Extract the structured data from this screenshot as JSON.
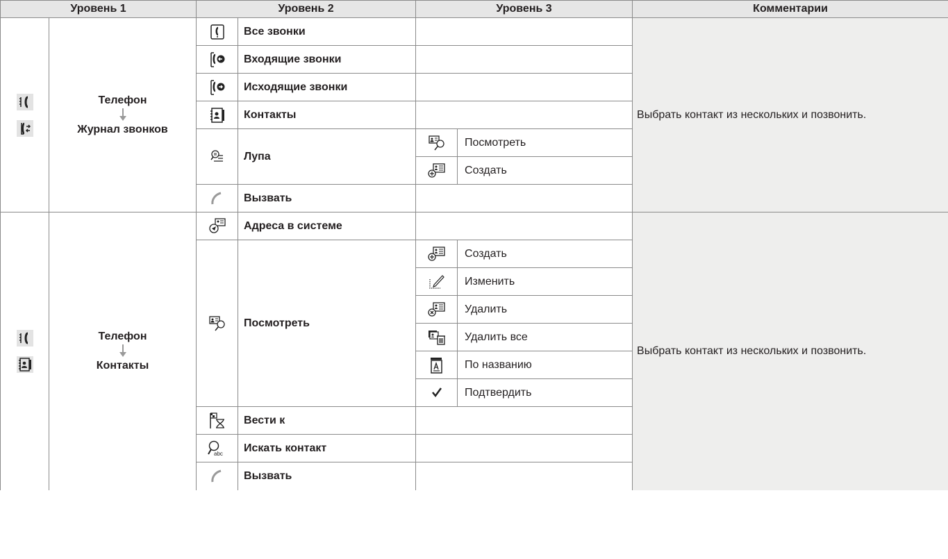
{
  "header": {
    "level1": "Уровень 1",
    "level2": "Уровень 2",
    "level3": "Уровень 3",
    "comments": "Комментарии"
  },
  "section1": {
    "path_top": "Телефон",
    "path_bottom": "Журнал звонков",
    "icons": [
      "phone-menu-icon",
      "call-log-icon"
    ],
    "comment": "Выбрать контакт из нескольких и позвонить.",
    "rows": [
      {
        "icon": "all-calls-icon",
        "label": "Все звонки"
      },
      {
        "icon": "incoming-calls-icon",
        "label": "Входящие звонки"
      },
      {
        "icon": "outgoing-calls-icon",
        "label": "Исходящие звонки"
      },
      {
        "icon": "contacts-icon",
        "label": "Контакты"
      },
      {
        "icon": "magnifier-list-icon",
        "label": "Лупа",
        "sub": [
          {
            "icon": "view-contact-icon",
            "label": "Посмотреть"
          },
          {
            "icon": "create-contact-icon",
            "label": "Создать"
          }
        ]
      },
      {
        "icon": "handset-icon",
        "label": "Вызвать"
      }
    ]
  },
  "section2": {
    "path_top": "Телефон",
    "path_bottom": "Контакты",
    "icons": [
      "phone-menu-icon",
      "contacts-icon"
    ],
    "comment": "Выбрать контакт из нескольких и позвонить.",
    "rows": [
      {
        "icon": "system-addresses-icon",
        "label": "Адреса в системе"
      },
      {
        "icon": "view-contact-icon",
        "label": "Посмотреть",
        "sub": [
          {
            "icon": "create-contact-icon",
            "label": "Создать"
          },
          {
            "icon": "edit-pencil-icon",
            "label": "Изменить"
          },
          {
            "icon": "delete-contact-icon",
            "label": "Удалить"
          },
          {
            "icon": "delete-all-icon",
            "label": "Удалить все"
          },
          {
            "icon": "sort-by-name-icon",
            "label": "По названию"
          },
          {
            "icon": "checkmark-icon",
            "label": "Подтвердить"
          }
        ]
      },
      {
        "icon": "navigate-to-icon",
        "label": "Вести к"
      },
      {
        "icon": "search-contact-icon",
        "label": "Искать контакт"
      },
      {
        "icon": "handset-icon",
        "label": "Вызвать"
      }
    ]
  }
}
